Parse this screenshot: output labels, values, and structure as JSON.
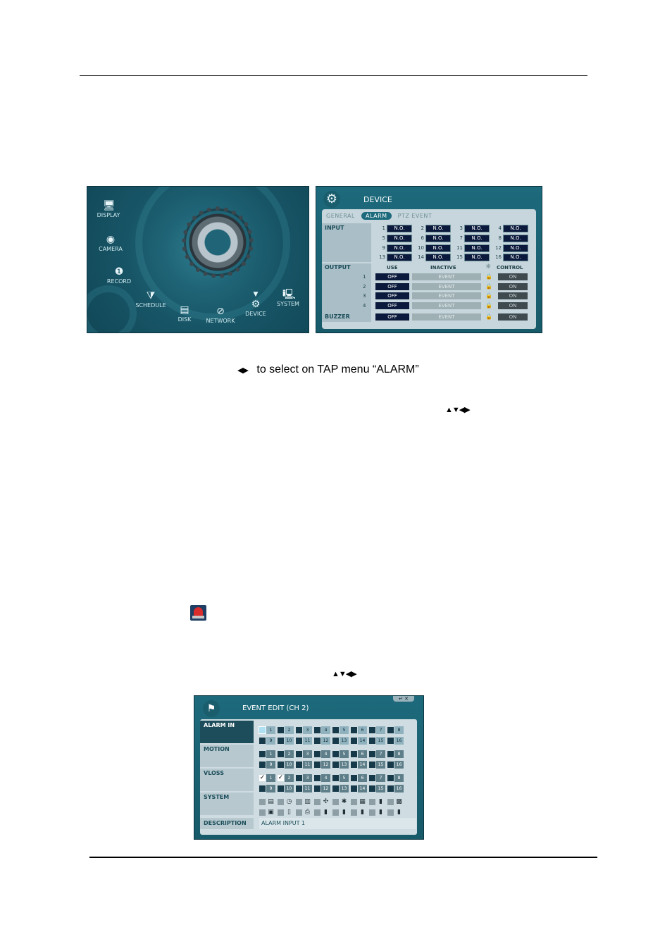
{
  "menu": {
    "items": [
      {
        "label": "DISPLAY",
        "icon": "monitor-icon"
      },
      {
        "label": "CAMERA",
        "icon": "camera-icon"
      },
      {
        "label": "RECORD",
        "icon": "record-icon"
      },
      {
        "label": "SCHEDULE",
        "icon": "schedule-icon"
      },
      {
        "label": "DISK",
        "icon": "disk-icon"
      },
      {
        "label": "NETWORK",
        "icon": "network-icon"
      },
      {
        "label": "DEVICE",
        "icon": "gear-icon"
      },
      {
        "label": "SYSTEM",
        "icon": "system-icon"
      }
    ]
  },
  "device": {
    "title": "DEVICE",
    "tabs": [
      "GENERAL",
      "ALARM",
      "PTZ EVENT"
    ],
    "active_tab": "ALARM",
    "input_label": "INPUT",
    "inputs": [
      {
        "n": "1",
        "v": "N.O."
      },
      {
        "n": "2",
        "v": "N.O."
      },
      {
        "n": "3",
        "v": "N.O."
      },
      {
        "n": "4",
        "v": "N.O."
      },
      {
        "n": "5",
        "v": "N.O."
      },
      {
        "n": "6",
        "v": "N.O."
      },
      {
        "n": "7",
        "v": "N.O."
      },
      {
        "n": "8",
        "v": "N.O."
      },
      {
        "n": "9",
        "v": "N.O."
      },
      {
        "n": "10",
        "v": "N.O."
      },
      {
        "n": "11",
        "v": "N.O."
      },
      {
        "n": "12",
        "v": "N.O."
      },
      {
        "n": "13",
        "v": "N.O."
      },
      {
        "n": "14",
        "v": "N.O."
      },
      {
        "n": "15",
        "v": "N.O."
      },
      {
        "n": "16",
        "v": "N.O."
      }
    ],
    "output_label": "OUTPUT",
    "col_use": "USE",
    "col_inactive": "INACTIVE",
    "col_control": "CONTROL",
    "outputs": [
      {
        "n": "1",
        "use": "OFF",
        "inactive": "EVENT",
        "control": "ON"
      },
      {
        "n": "2",
        "use": "OFF",
        "inactive": "EVENT",
        "control": "ON"
      },
      {
        "n": "3",
        "use": "OFF",
        "inactive": "EVENT",
        "control": "ON"
      },
      {
        "n": "4",
        "use": "OFF",
        "inactive": "EVENT",
        "control": "ON"
      }
    ],
    "buzzer": {
      "label": "BUZZER",
      "use": "OFF",
      "inactive": "EVENT",
      "control": "ON"
    }
  },
  "text": {
    "line1": "to select on TAP menu “ALARM”"
  },
  "event_edit": {
    "title": "EVENT EDIT (CH 2)",
    "rows": [
      {
        "label": "ALARM IN",
        "checked": []
      },
      {
        "label": "MOTION",
        "checked": []
      },
      {
        "label": "VLOSS",
        "checked": [
          "1",
          "2"
        ]
      },
      {
        "label": "SYSTEM",
        "checked": []
      }
    ],
    "numbers_top": [
      "1",
      "2",
      "3",
      "4",
      "5",
      "6",
      "7",
      "8"
    ],
    "numbers_bottom": [
      "9",
      "10",
      "11",
      "12",
      "13",
      "14",
      "15",
      "16"
    ],
    "description_label": "DESCRIPTION",
    "description_value": "ALARM INPUT 1"
  }
}
